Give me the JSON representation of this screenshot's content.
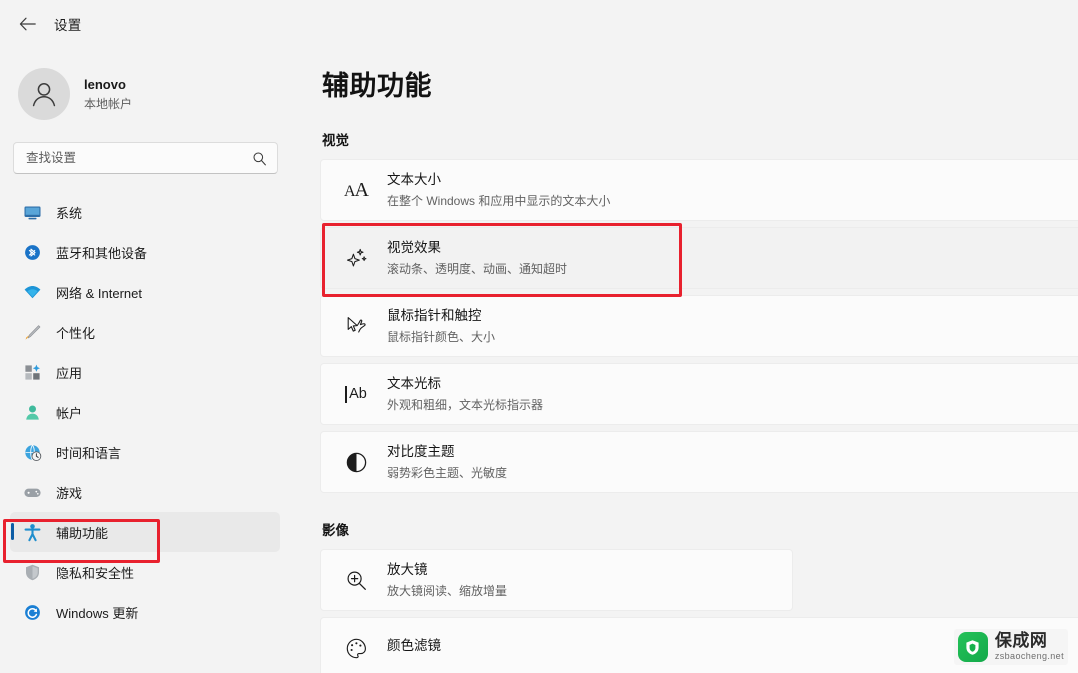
{
  "window": {
    "title": "设置",
    "back_icon": "back-arrow-icon"
  },
  "account": {
    "name": "lenovo",
    "subtitle": "本地帐户",
    "avatar_icon": "user-avatar-icon"
  },
  "search": {
    "placeholder": "查找设置",
    "value": "",
    "icon": "search-icon"
  },
  "sidebar": {
    "items": [
      {
        "label": "系统",
        "icon": "monitor-icon",
        "selected": false
      },
      {
        "label": "蓝牙和其他设备",
        "icon": "bluetooth-icon",
        "selected": false
      },
      {
        "label": "网络 & Internet",
        "icon": "wifi-icon",
        "selected": false
      },
      {
        "label": "个性化",
        "icon": "paintbrush-icon",
        "selected": false
      },
      {
        "label": "应用",
        "icon": "apps-grid-icon",
        "selected": false
      },
      {
        "label": "帐户",
        "icon": "person-icon",
        "selected": false
      },
      {
        "label": "时间和语言",
        "icon": "clock-globe-icon",
        "selected": false
      },
      {
        "label": "游戏",
        "icon": "gamepad-icon",
        "selected": false
      },
      {
        "label": "辅助功能",
        "icon": "accessibility-person-icon",
        "selected": true
      },
      {
        "label": "隐私和安全性",
        "icon": "shield-icon",
        "selected": false
      },
      {
        "label": "Windows 更新",
        "icon": "windows-update-icon",
        "selected": false
      }
    ]
  },
  "main": {
    "page_title": "辅助功能",
    "sections": [
      {
        "heading": "视觉",
        "rows": [
          {
            "title": "文本大小",
            "subtitle": "在整个 Windows 和应用中显示的文本大小",
            "icon": "text-size-aa-icon",
            "highlighted": false
          },
          {
            "title": "视觉效果",
            "subtitle": "滚动条、透明度、动画、通知超时",
            "icon": "sparkle-icon",
            "highlighted": true
          },
          {
            "title": "鼠标指针和触控",
            "subtitle": "鼠标指针颜色、大小",
            "icon": "mouse-pointer-touch-icon",
            "highlighted": false
          },
          {
            "title": "文本光标",
            "subtitle": "外观和粗细，文本光标指示器",
            "icon": "text-cursor-ab-icon",
            "highlighted": false
          },
          {
            "title": "对比度主题",
            "subtitle": "弱势彩色主题、光敏度",
            "icon": "contrast-circle-icon",
            "highlighted": false
          }
        ]
      },
      {
        "heading": "影像",
        "rows": [
          {
            "title": "放大镜",
            "subtitle": "放大镜阅读、缩放增量",
            "icon": "magnifier-plus-icon",
            "highlighted": false
          },
          {
            "title": "颜色滤镜",
            "subtitle": "",
            "icon": "color-filter-palette-icon",
            "highlighted": false
          }
        ]
      }
    ]
  },
  "annotations": {
    "highlight_color": "#e8212e",
    "boxes": [
      {
        "name": "sidebar-accessibility-highlight"
      },
      {
        "name": "visual-effects-row-highlight"
      }
    ]
  },
  "watermark": {
    "brand_cn": "保成网",
    "brand_domain": "zsbaocheng.net",
    "logo_icon": "shield-logo-icon",
    "logo_color": "#17b14c"
  }
}
